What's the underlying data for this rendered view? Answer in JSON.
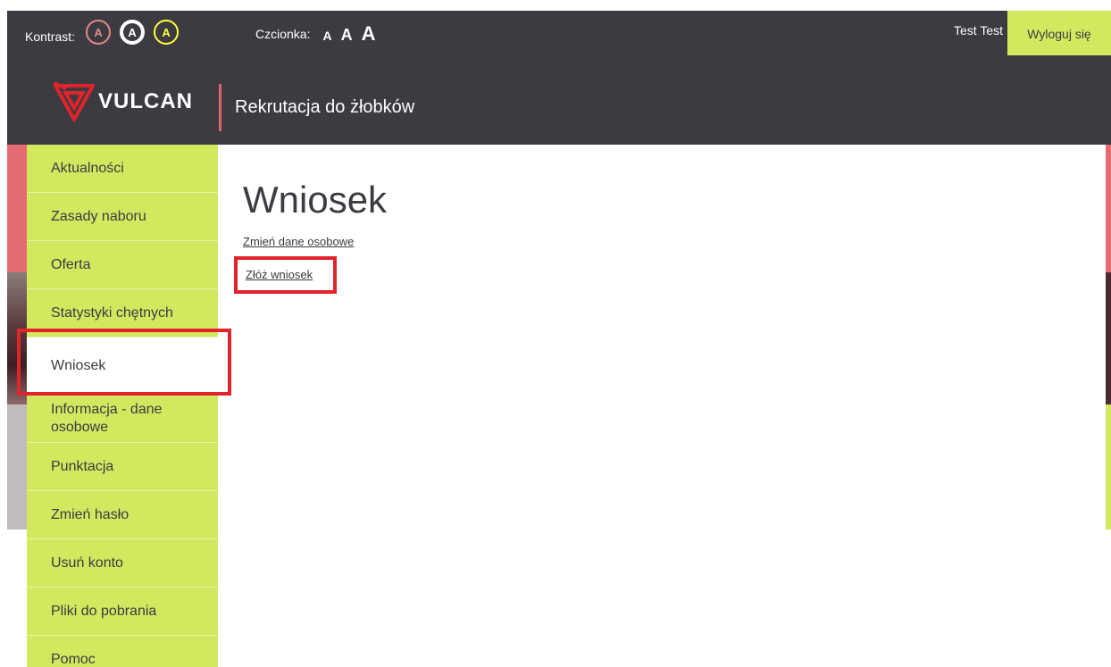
{
  "topbar": {
    "contrast_label": "Kontrast:",
    "contrast_buttons": [
      "A",
      "A",
      "A"
    ],
    "font_label": "Czcionka:",
    "font_sizes": [
      "A",
      "A",
      "A"
    ],
    "user_name": "Test Test",
    "logout_label": "Wyloguj się"
  },
  "header": {
    "logo_text": "VULCAN",
    "app_title": "Rekrutacja do żłobków"
  },
  "sidebar": {
    "items": [
      {
        "label": "Aktualności"
      },
      {
        "label": "Zasady naboru"
      },
      {
        "label": "Oferta"
      },
      {
        "label": "Statystyki chętnych"
      },
      {
        "label": "Wniosek"
      },
      {
        "label_line1": "Informacja - dane",
        "label_line2": "osobowe"
      },
      {
        "label": "Punktacja"
      },
      {
        "label": "Zmień hasło"
      },
      {
        "label": "Usuń konto"
      },
      {
        "label": "Pliki do pobrania"
      },
      {
        "label": "Pomoc"
      }
    ],
    "active": "Wniosek"
  },
  "main": {
    "title": "Wniosek",
    "links": [
      "Zmień dane osobowe",
      "Złóż wniosek"
    ]
  },
  "colors": {
    "dark": "#3b3b41",
    "lime": "#d4e85f",
    "accent_red": "#e2646a",
    "highlight": "#e2232b"
  }
}
